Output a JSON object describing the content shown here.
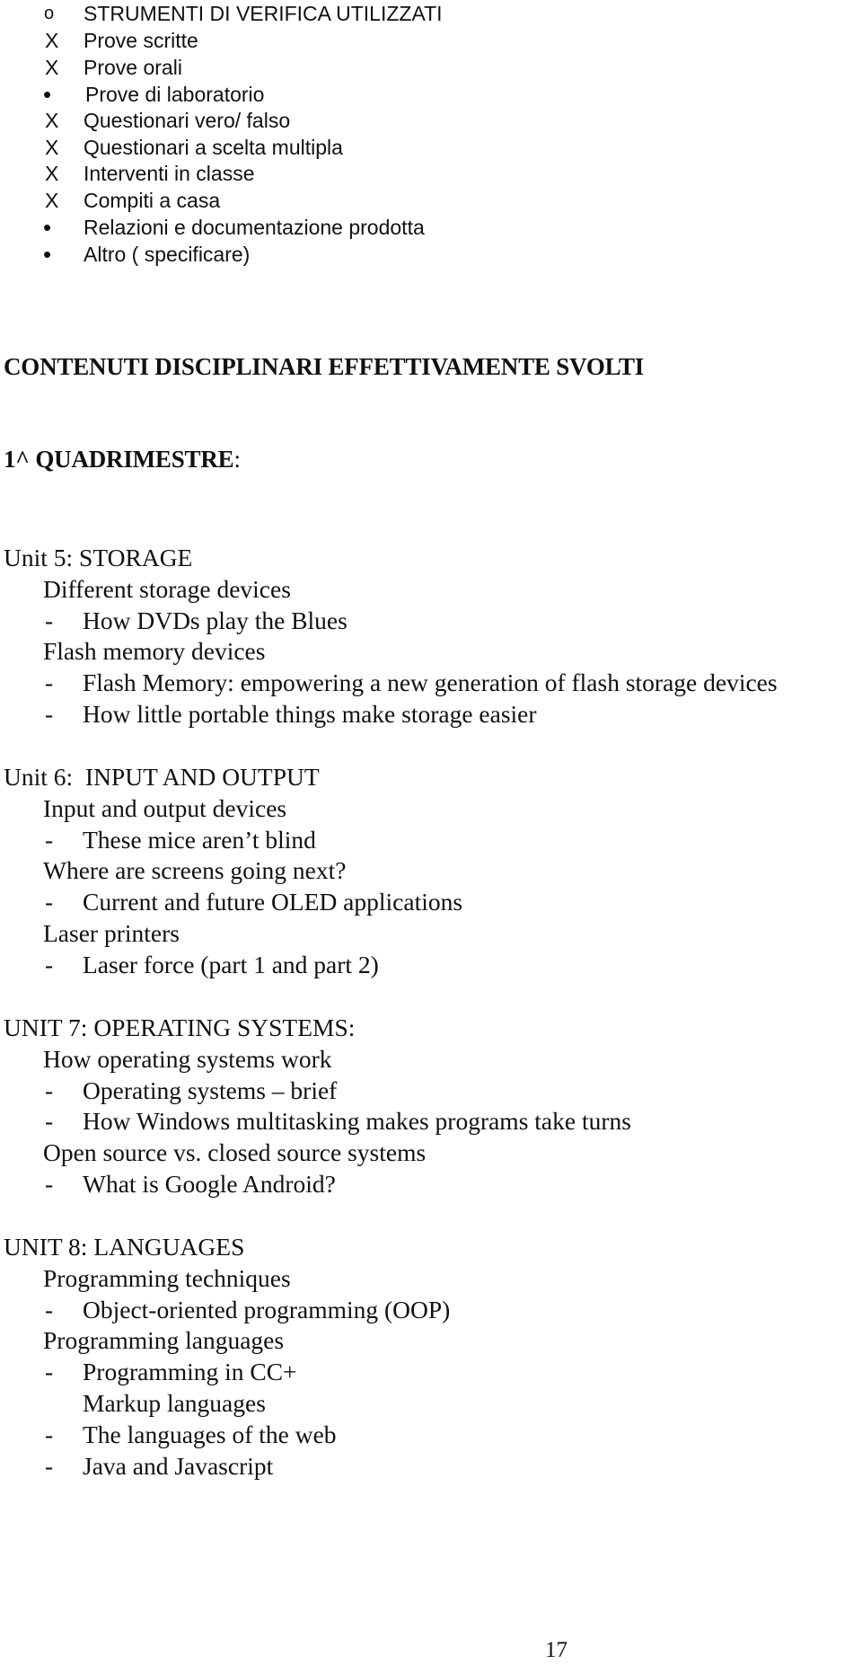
{
  "checklist": {
    "items": [
      {
        "marker": "o",
        "marker_type": "circle",
        "label": "STRUMENTI DI VERIFICA UTILIZZATI"
      },
      {
        "marker": "X",
        "marker_type": "x",
        "label": "Prove scritte"
      },
      {
        "marker": "X",
        "marker_type": "x",
        "label": "Prove orali"
      },
      {
        "marker": "•",
        "marker_type": "bullet",
        "label": "Prove di laboratorio"
      },
      {
        "marker": "X",
        "marker_type": "x",
        "label": "Questionari vero/ falso"
      },
      {
        "marker": "X",
        "marker_type": "x",
        "label": "Questionari a scelta multipla"
      },
      {
        "marker": "X",
        "marker_type": "x",
        "label": "Interventi in classe"
      },
      {
        "marker": "X",
        "marker_type": "x",
        "label": "Compiti a casa"
      },
      {
        "marker": "•",
        "marker_type": "bullet",
        "label": "Relazioni e documentazione prodotta"
      },
      {
        "marker": "•",
        "marker_type": "bullet",
        "label": "Altro ( specificare)"
      }
    ]
  },
  "section_title": "CONTENUTI DISCIPLINARI EFFETTIVAMENTE SVOLTI",
  "period_title": "1^ QUADRIMESTRE",
  "period_colon": ":",
  "units": [
    {
      "title": "Unit 5: STORAGE",
      "lines": [
        {
          "type": "topic",
          "text": "Different storage devices"
        },
        {
          "type": "sub",
          "dash": "-",
          "text": "How DVDs play the Blues"
        },
        {
          "type": "topic",
          "text": "Flash memory devices"
        },
        {
          "type": "sub",
          "dash": "-",
          "text": "Flash Memory: empowering a new generation of flash storage devices"
        },
        {
          "type": "sub",
          "dash": "-",
          "text": "How little portable things make storage easier"
        }
      ]
    },
    {
      "title": "Unit 6:  INPUT AND OUTPUT",
      "lines": [
        {
          "type": "topic",
          "text": "Input and output devices"
        },
        {
          "type": "sub",
          "dash": "-",
          "text": "These mice aren’t blind"
        },
        {
          "type": "topic",
          "text": "Where are screens going next?"
        },
        {
          "type": "sub",
          "dash": "-",
          "text": "Current and future OLED applications"
        },
        {
          "type": "topic",
          "text": "Laser printers"
        },
        {
          "type": "sub",
          "dash": "-",
          "text": "Laser force (part 1 and part 2)"
        }
      ]
    },
    {
      "title": "UNIT 7: OPERATING SYSTEMS:",
      "lines": [
        {
          "type": "topic",
          "text": "How operating systems work"
        },
        {
          "type": "sub",
          "dash": "-",
          "text": "Operating systems – brief"
        },
        {
          "type": "sub",
          "dash": "-",
          "text": "How Windows multitasking makes programs take turns"
        },
        {
          "type": "topic",
          "text": "Open source vs. closed source systems"
        },
        {
          "type": "sub",
          "dash": "-",
          "text": "What is Google Android?"
        }
      ]
    },
    {
      "title": "UNIT 8: LANGUAGES",
      "lines": [
        {
          "type": "topic",
          "text": "Programming techniques"
        },
        {
          "type": "sub",
          "dash": "-",
          "text": "Object-oriented programming (OOP)"
        },
        {
          "type": "topic",
          "text": "Programming languages"
        },
        {
          "type": "sub",
          "dash": "-",
          "text": "Programming in CC+"
        },
        {
          "type": "plain-sub",
          "text": "Markup languages"
        },
        {
          "type": "sub",
          "dash": "-",
          "text": "The languages of the web"
        },
        {
          "type": "sub",
          "dash": "-",
          "text": "Java and Javascript"
        }
      ]
    }
  ],
  "page_number": "17"
}
